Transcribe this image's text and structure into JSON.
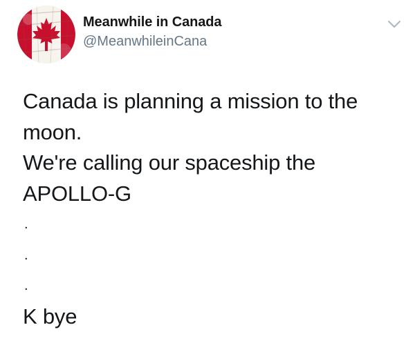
{
  "tweet": {
    "author": {
      "display_name": "Meanwhile in Canada",
      "handle": "@MeanwhileinCana",
      "avatar_icon": "canada-flag-avatar-icon"
    },
    "menu_icon": "chevron-down-icon",
    "text_lines": [
      "Canada is planning a mission to the",
      "moon.",
      "We're calling our spaceship the",
      "APOLLO-G",
      ".",
      ".",
      ".",
      "K bye"
    ]
  },
  "colors": {
    "text": "#14171a",
    "handle": "#657786",
    "flag_red": "#c8102e",
    "caret": "#aab8c2"
  }
}
